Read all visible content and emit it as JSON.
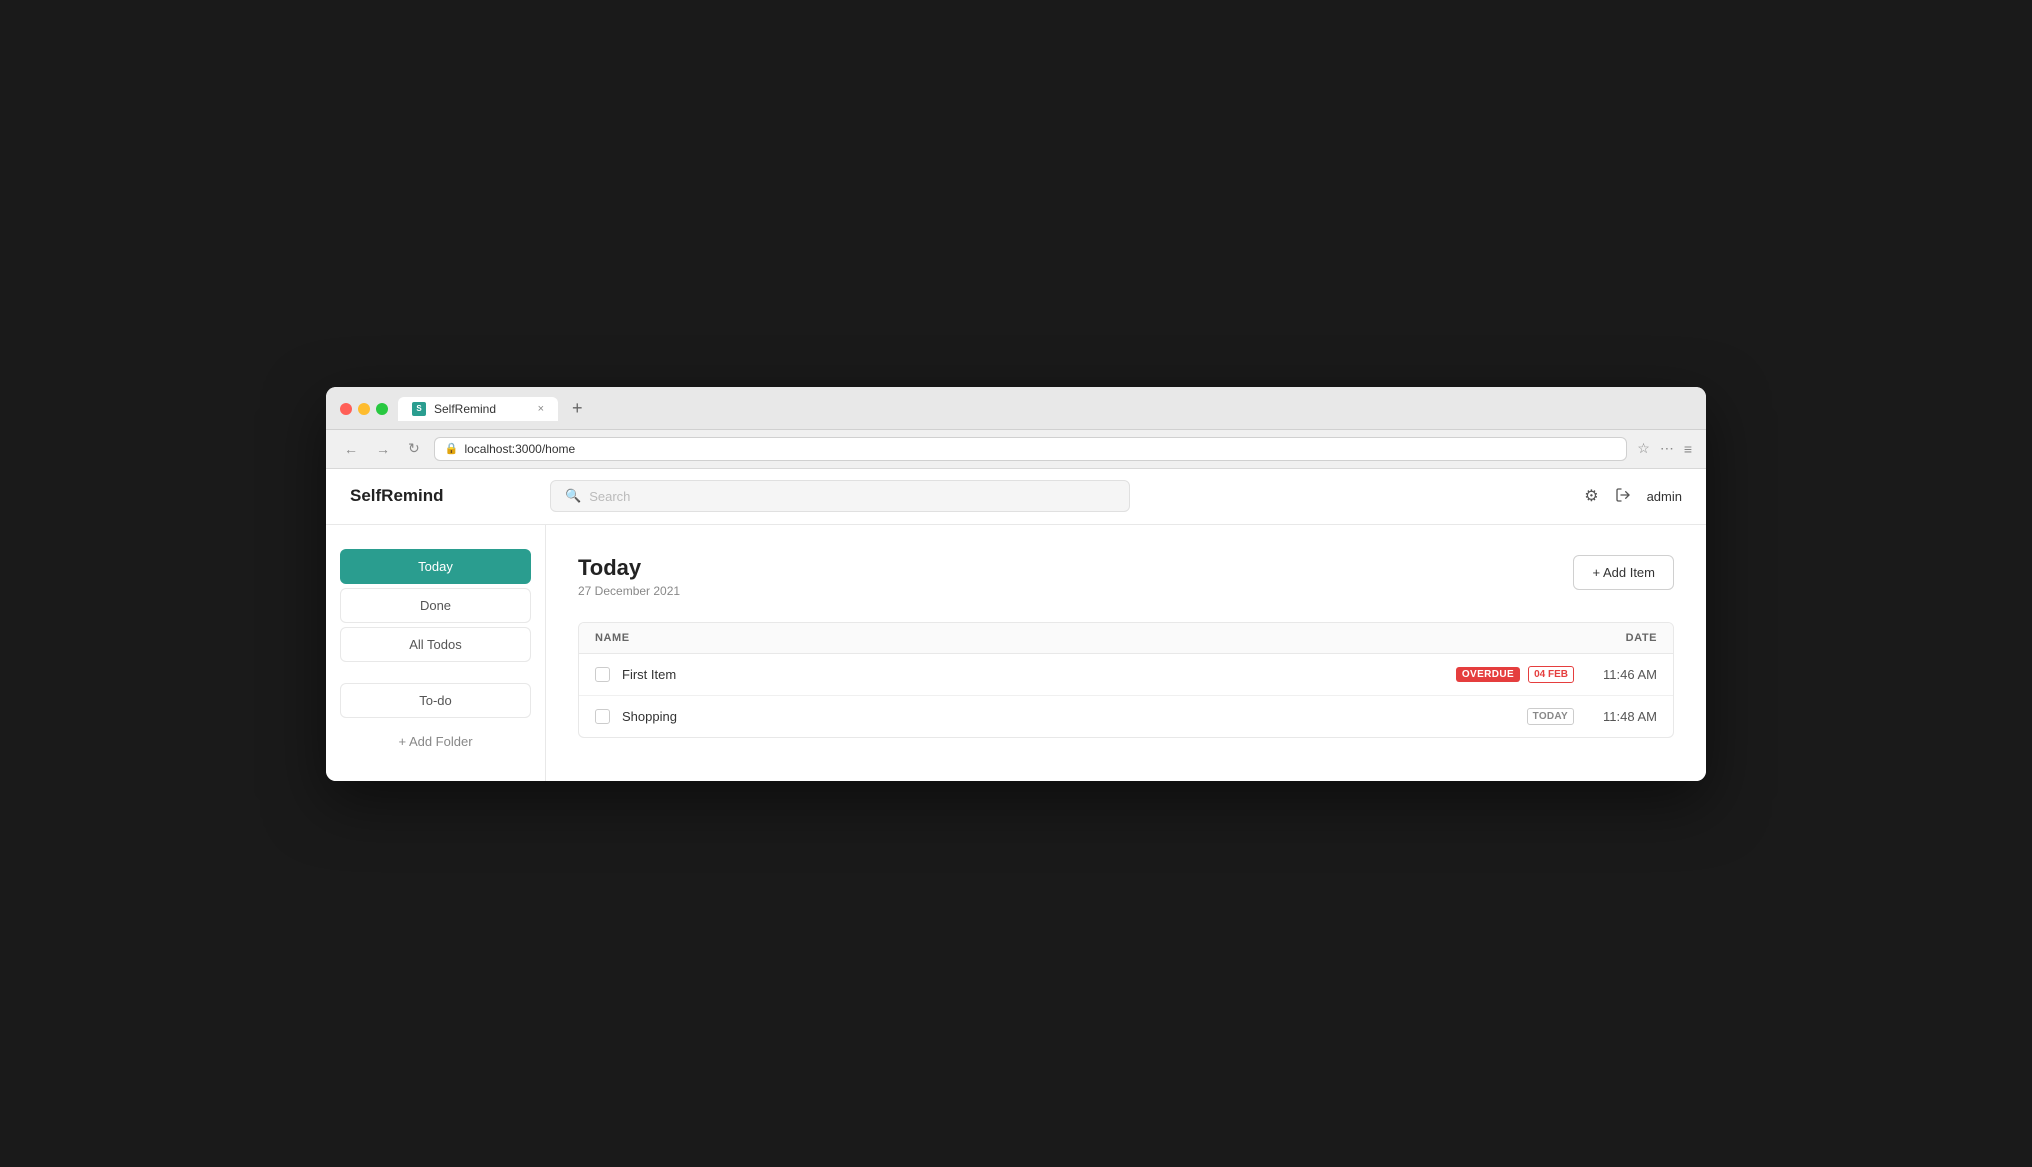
{
  "browser": {
    "tab_title": "SelfRemind",
    "tab_favicon": "S",
    "url": "localhost:3000/home",
    "new_tab_symbol": "+",
    "close_symbol": "×",
    "nav": {
      "back": "←",
      "forward": "→",
      "refresh": "↻"
    }
  },
  "app": {
    "logo": "SelfRemind",
    "search_placeholder": "Search",
    "search_icon": "🔍",
    "header_icons": {
      "settings": "⚙",
      "logout": "⮕"
    },
    "username": "admin"
  },
  "sidebar": {
    "nav_items": [
      {
        "label": "Today",
        "active": true
      },
      {
        "label": "Done",
        "active": false
      },
      {
        "label": "All Todos",
        "active": false
      }
    ],
    "folders": [
      {
        "label": "To-do"
      }
    ],
    "add_folder_label": "+ Add Folder"
  },
  "main": {
    "title": "Today",
    "subtitle": "27 December 2021",
    "add_button_label": "+ Add Item",
    "table": {
      "col_name": "NAME",
      "col_date": "DATE",
      "rows": [
        {
          "name": "First Item",
          "badge_overdue": "OVERDUE",
          "badge_date": "04 FEB",
          "time": "11:46 AM"
        },
        {
          "name": "Shopping",
          "badge_today": "TODAY",
          "time": "11:48 AM"
        }
      ]
    }
  }
}
